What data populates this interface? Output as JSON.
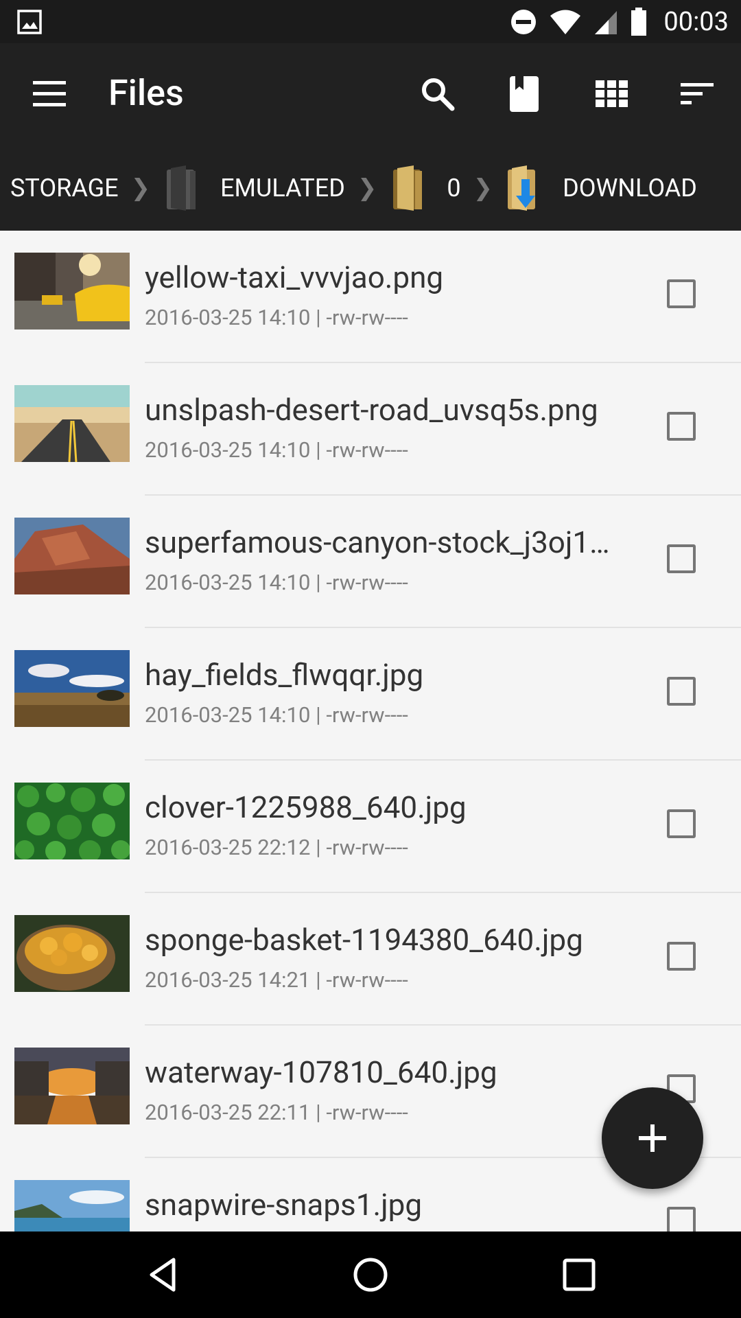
{
  "status": {
    "time": "00:03"
  },
  "toolbar": {
    "title": "Files",
    "icons": [
      "search-icon",
      "bookmark-icon",
      "grid-view-icon",
      "sort-icon"
    ]
  },
  "breadcrumb": {
    "items": [
      {
        "label": "STORAGE",
        "icon": "none"
      },
      {
        "label": "EMULATED",
        "icon": "folder-dark-icon"
      },
      {
        "label": "0",
        "icon": "folder-yellow-icon"
      },
      {
        "label": "DOWNLOAD",
        "icon": "download-folder-icon"
      }
    ]
  },
  "files": [
    {
      "name": "yellow-taxi_vvvjao.png",
      "meta": "2016-03-25 14:10 | -rw-rw----"
    },
    {
      "name": "unslpash-desert-road_uvsq5s.png",
      "meta": "2016-03-25 14:10 | -rw-rw----"
    },
    {
      "name": "superfamous-canyon-stock_j3oj1…",
      "meta": "2016-03-25 14:10 | -rw-rw----"
    },
    {
      "name": "hay_fields_flwqqr.jpg",
      "meta": "2016-03-25 14:10 | -rw-rw----"
    },
    {
      "name": "clover-1225988_640.jpg",
      "meta": "2016-03-25 22:12 | -rw-rw----"
    },
    {
      "name": "sponge-basket-1194380_640.jpg",
      "meta": "2016-03-25 14:21 | -rw-rw----"
    },
    {
      "name": "waterway-107810_640.jpg",
      "meta": "2016-03-25 22:11 | -rw-rw----"
    },
    {
      "name": "snapwire-snaps1.jpg",
      "meta": ""
    }
  ],
  "colors": {
    "toolbar": "#212121",
    "status_bar": "#1b1b1b",
    "fab": "#212121",
    "background": "#f5f5f5"
  }
}
